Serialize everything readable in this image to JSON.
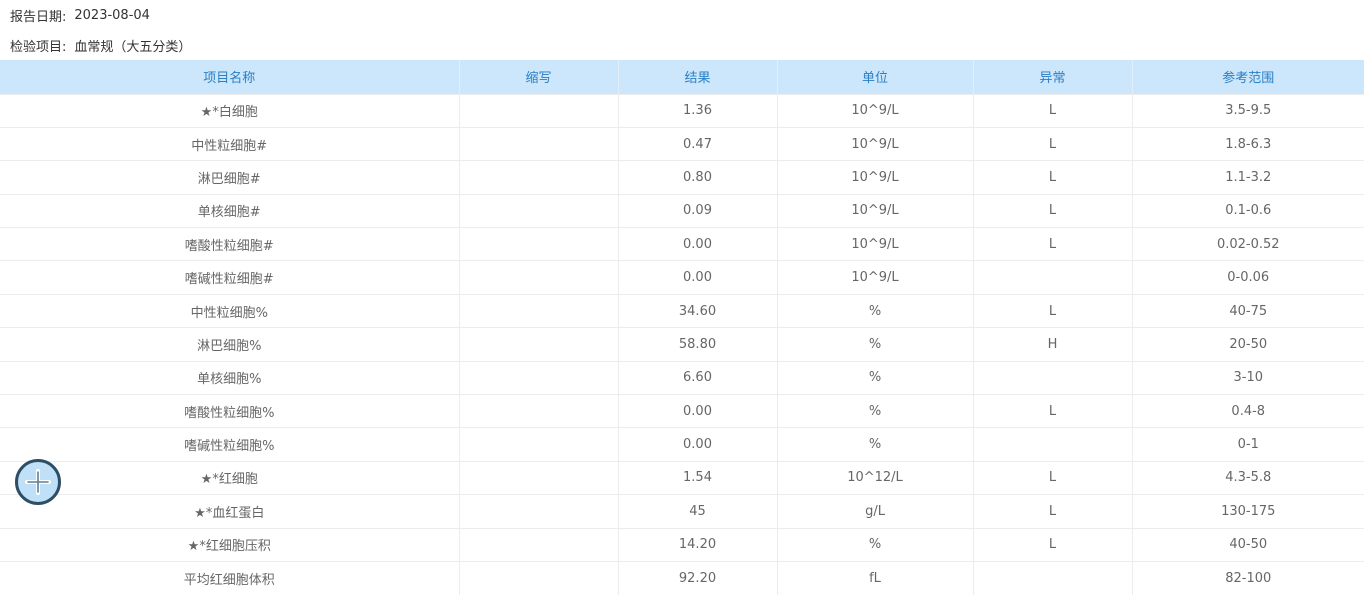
{
  "report": {
    "date_label": "报告日期:",
    "date_value": "2023-08-04",
    "item_label": "检验项目:",
    "item_value": "血常规（大五分类）"
  },
  "table": {
    "headers": [
      "项目名称",
      "缩写",
      "结果",
      "单位",
      "异常",
      "参考范围"
    ],
    "rows": [
      {
        "name": "★*白细胞",
        "abbr": "",
        "result": "1.36",
        "unit": "10^9/L",
        "flag": "L",
        "range": "3.5-9.5"
      },
      {
        "name": "中性粒细胞#",
        "abbr": "",
        "result": "0.47",
        "unit": "10^9/L",
        "flag": "L",
        "range": "1.8-6.3"
      },
      {
        "name": "淋巴细胞#",
        "abbr": "",
        "result": "0.80",
        "unit": "10^9/L",
        "flag": "L",
        "range": "1.1-3.2"
      },
      {
        "name": "单核细胞#",
        "abbr": "",
        "result": "0.09",
        "unit": "10^9/L",
        "flag": "L",
        "range": "0.1-0.6"
      },
      {
        "name": "嗜酸性粒细胞#",
        "abbr": "",
        "result": "0.00",
        "unit": "10^9/L",
        "flag": "L",
        "range": "0.02-0.52"
      },
      {
        "name": "嗜碱性粒细胞#",
        "abbr": "",
        "result": "0.00",
        "unit": "10^9/L",
        "flag": "",
        "range": "0-0.06"
      },
      {
        "name": "中性粒细胞%",
        "abbr": "",
        "result": "34.60",
        "unit": "%",
        "flag": "L",
        "range": "40-75"
      },
      {
        "name": "淋巴细胞%",
        "abbr": "",
        "result": "58.80",
        "unit": "%",
        "flag": "H",
        "range": "20-50"
      },
      {
        "name": "单核细胞%",
        "abbr": "",
        "result": "6.60",
        "unit": "%",
        "flag": "",
        "range": "3-10"
      },
      {
        "name": "嗜酸性粒细胞%",
        "abbr": "",
        "result": "0.00",
        "unit": "%",
        "flag": "L",
        "range": "0.4-8"
      },
      {
        "name": "嗜碱性粒细胞%",
        "abbr": "",
        "result": "0.00",
        "unit": "%",
        "flag": "",
        "range": "0-1"
      },
      {
        "name": "★*红细胞",
        "abbr": "",
        "result": "1.54",
        "unit": "10^12/L",
        "flag": "L",
        "range": "4.3-5.8"
      },
      {
        "name": "★*血红蛋白",
        "abbr": "",
        "result": "45",
        "unit": "g/L",
        "flag": "L",
        "range": "130-175"
      },
      {
        "name": "★*红细胞压积",
        "abbr": "",
        "result": "14.20",
        "unit": "%",
        "flag": "L",
        "range": "40-50"
      },
      {
        "name": "平均红细胞体积",
        "abbr": "",
        "result": "92.20",
        "unit": "fL",
        "flag": "",
        "range": "82-100"
      }
    ]
  },
  "fab": {
    "icon": "plus-icon"
  }
}
